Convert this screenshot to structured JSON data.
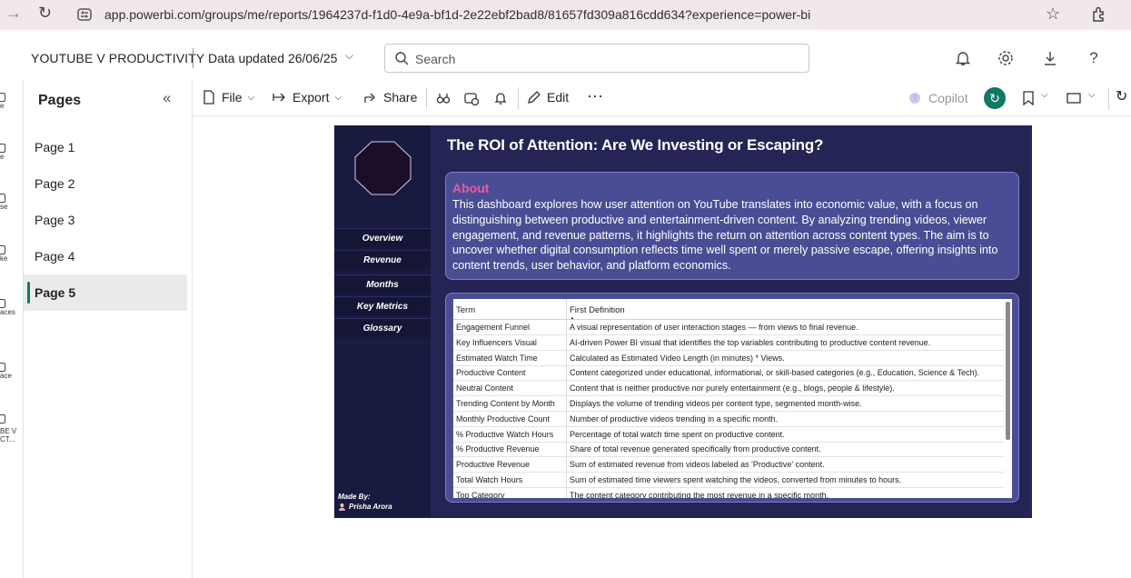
{
  "browser": {
    "url": "app.powerbi.com/groups/me/reports/1964237d-f1d0-4e9a-bf1d-2e22ebf2bad8/81657fd309a816cdd634?experience=power-bi"
  },
  "header": {
    "report_title": "YOUTUBE V PRODUCTIVITY",
    "data_updated": "Data updated 26/06/25",
    "search_placeholder": "Search"
  },
  "left_rail": {
    "items": [
      "e",
      "e",
      "se",
      "ke",
      "aces",
      "ace",
      "BE V",
      "CT..."
    ]
  },
  "pages_pane": {
    "title": "Pages",
    "pages": [
      "Page 1",
      "Page 2",
      "Page 3",
      "Page 4",
      "Page 5"
    ],
    "active_index": 4
  },
  "toolbar": {
    "file": "File",
    "export": "Export",
    "share": "Share",
    "edit": "Edit",
    "copilot": "Copilot"
  },
  "report": {
    "title": "The ROI of Attention: Are We Investing or Escaping?",
    "nav": [
      "Overview",
      "Revenue",
      "Months",
      "Key Metrics",
      "Glossary"
    ],
    "made_by_label": "Made By:",
    "author": "Prisha Arora",
    "about_heading": "About",
    "about_text": "This dashboard explores how user attention on YouTube translates into economic value, with a focus on distinguishing between productive and entertainment-driven content. By analyzing trending videos, viewer engagement, and revenue patterns, it highlights the return on attention across content types. The aim is to uncover whether digital consumption reflects time well spent or merely passive escape, offering insights into content trends, user behavior, and platform economics.",
    "glossary": {
      "col_term": "Term",
      "col_def": "First Definition",
      "rows": [
        {
          "term": "Engagement Funnel",
          "def": "A visual representation of user interaction stages — from views to final revenue."
        },
        {
          "term": "Key Influencers Visual",
          "def": "AI-driven Power BI visual that identifies the top variables contributing to productive content revenue."
        },
        {
          "term": "Estimated Watch Time",
          "def": "Calculated as Estimated Video Length (in minutes) * Views."
        },
        {
          "term": "Productive Content",
          "def": "Content categorized under educational, informational, or skill-based categories (e.g., Education, Science & Tech)."
        },
        {
          "term": "Neutral Content",
          "def": "Content that is neither productive nor purely entertainment (e.g., blogs, people & lifestyle)."
        },
        {
          "term": "Trending Content by Month",
          "def": "Displays the volume of trending videos per content type, segmented month-wise."
        },
        {
          "term": "Monthly Productive Count",
          "def": "Number of productive videos trending in a specific month."
        },
        {
          "term": "% Productive Watch Hours",
          "def": "Percentage of total watch time spent on productive content."
        },
        {
          "term": "% Productive Revenue",
          "def": "Share of total revenue generated specifically from productive content."
        },
        {
          "term": "Productive Revenue",
          "def": "Sum of estimated revenue from videos labeled as 'Productive' content."
        },
        {
          "term": "Total Watch Hours",
          "def": "Sum of estimated time viewers spent watching the videos, converted from minutes to hours."
        },
        {
          "term": "Top Category",
          "def": "The content category contributing the most revenue in a specific month."
        }
      ]
    }
  },
  "colors": {
    "accent_teal": "#117865",
    "about_heading": "#e95aa0",
    "report_bg": "#242455"
  }
}
